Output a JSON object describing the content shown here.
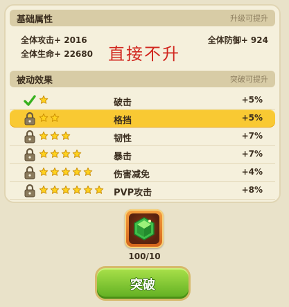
{
  "basic": {
    "title": "基础属性",
    "hint": "升级可提升",
    "attack": "全体攻击+ 2016",
    "defense": "全体防御+ 924",
    "life": "全体生命+ 22680",
    "note": "直接不升"
  },
  "passive": {
    "title": "被动效果",
    "hint": "突破可提升",
    "rows": [
      {
        "status": "unlocked",
        "stars": 1,
        "name": "破击",
        "value": "+5%"
      },
      {
        "status": "locked",
        "stars": 2,
        "name": "格挡",
        "value": "+5%",
        "highlight": true
      },
      {
        "status": "locked",
        "stars": 3,
        "name": "韧性",
        "value": "+7%"
      },
      {
        "status": "locked",
        "stars": 4,
        "name": "暴击",
        "value": "+7%"
      },
      {
        "status": "locked",
        "stars": 5,
        "name": "伤害减免",
        "value": "+4%"
      },
      {
        "status": "locked",
        "stars": 6,
        "name": "PVP攻击",
        "value": "+8%"
      }
    ]
  },
  "item": {
    "icon": "green-gem-icon",
    "count": "100/10"
  },
  "button": {
    "label": "突破"
  },
  "colors": {
    "accent": "#f9c933",
    "note": "#d1261e",
    "button": "#6fbf2a"
  }
}
